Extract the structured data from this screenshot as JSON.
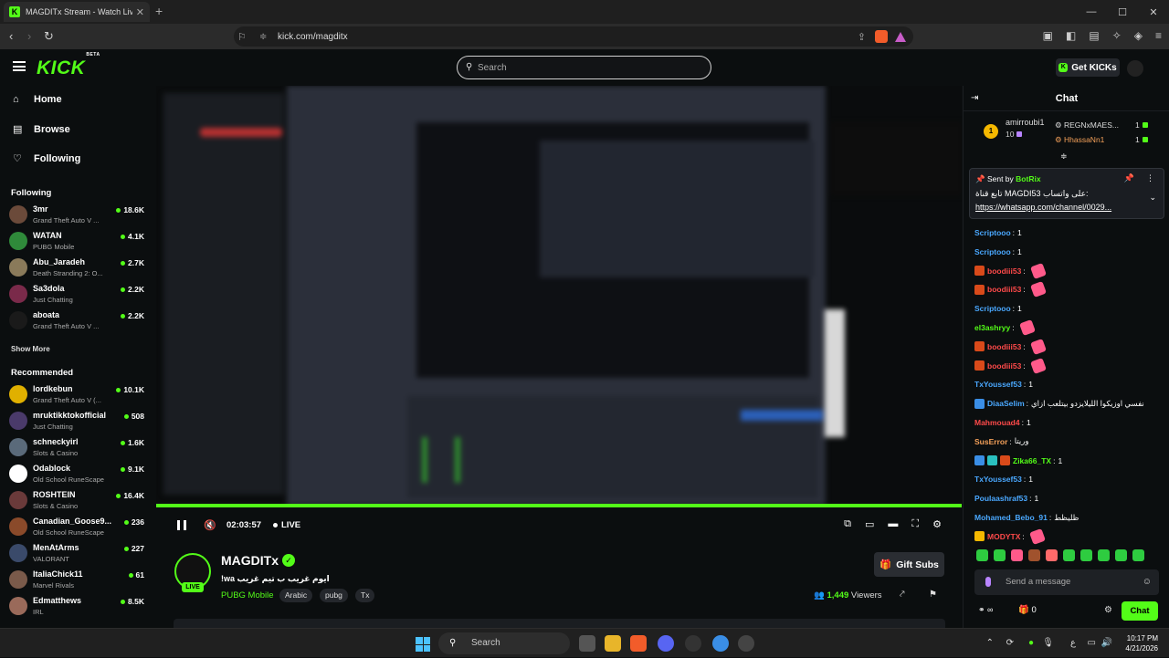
{
  "browser": {
    "tab_title": "MAGDITx Stream - Watch Live on Kick",
    "url": "kick.com/magditx"
  },
  "header": {
    "logo": "KICK",
    "logo_badge": "BETA",
    "search_placeholder": "Search",
    "get_kicks": "Get KICKs"
  },
  "sidebar": {
    "nav": [
      {
        "label": "Home",
        "icon": "home-icon"
      },
      {
        "label": "Browse",
        "icon": "browse-icon"
      },
      {
        "label": "Following",
        "icon": "heart-icon"
      }
    ],
    "following_title": "Following",
    "following": [
      {
        "name": "3mr",
        "category": "Grand Theft Auto V ...",
        "viewers": "18.6K",
        "color": "#6b4a3a"
      },
      {
        "name": "WATAN",
        "category": "PUBG Mobile",
        "viewers": "4.1K",
        "color": "#2f8a3a"
      },
      {
        "name": "Abu_Jaradeh",
        "category": "Death Stranding 2: O...",
        "viewers": "2.7K",
        "color": "#8a7a5a"
      },
      {
        "name": "Sa3dola",
        "category": "Just Chatting",
        "viewers": "2.2K",
        "color": "#7a2a4a"
      },
      {
        "name": "aboata",
        "category": "Grand Theft Auto V ...",
        "viewers": "2.2K",
        "color": "#1a1a1a"
      }
    ],
    "show_more": "Show More",
    "recommended_title": "Recommended",
    "recommended": [
      {
        "name": "lordkebun",
        "category": "Grand Theft Auto V (...",
        "viewers": "10.1K",
        "color": "#e0b000"
      },
      {
        "name": "mruktikktokofficial",
        "category": "Just Chatting",
        "viewers": "508",
        "color": "#4a3a6a"
      },
      {
        "name": "schneckyirl",
        "category": "Slots & Casino",
        "viewers": "1.6K",
        "color": "#5a6a7a"
      },
      {
        "name": "Odablock",
        "category": "Old School RuneScape",
        "viewers": "9.1K",
        "color": "#ffffff"
      },
      {
        "name": "ROSHTEIN",
        "category": "Slots & Casino",
        "viewers": "16.4K",
        "color": "#6a3a3a"
      },
      {
        "name": "Canadian_Goose9...",
        "category": "Old School RuneScape",
        "viewers": "236",
        "color": "#8a4a2a"
      },
      {
        "name": "MenAtArms",
        "category": "VALORANT",
        "viewers": "227",
        "color": "#3a4a6a"
      },
      {
        "name": "ItaliaChick11",
        "category": "Marvel Rivals",
        "viewers": "61",
        "color": "#7a5a4a"
      },
      {
        "name": "Edmatthews",
        "category": "IRL",
        "viewers": "8.5K",
        "color": "#9a6a5a"
      }
    ]
  },
  "player": {
    "elapsed": "02:03:57",
    "live": "LIVE",
    "progress": 1.0
  },
  "stream": {
    "channel": "MAGDITx",
    "live_badge": "LIVE",
    "title": "!wa ايوم غريب ب تيم غريب",
    "category": "PUBG Mobile",
    "tags": [
      "Arabic",
      "pubg",
      "Tx"
    ],
    "gift_subs": "Gift Subs",
    "viewers": "1,449",
    "viewers_label": "Viewers"
  },
  "chat": {
    "title": "Chat",
    "leaderboard": {
      "top_name": "amirroubi1",
      "top_count": "10",
      "top_rank": "1",
      "others": [
        {
          "name": "REGNxMAES...",
          "count": "1"
        },
        {
          "name": "HhassaNn1",
          "count": "1"
        }
      ]
    },
    "pinned": {
      "sent_by": "Sent by",
      "bot": "BotRix",
      "message": "تابع قناة MAGDI53 على واتساب:",
      "link": "https://whatsapp.com/channel/0029..."
    },
    "messages": [
      {
        "user": "Scriptooo",
        "text": "1",
        "color": "#4aa8ff",
        "badge": "",
        "emote": false
      },
      {
        "user": "Scriptooo",
        "text": "1",
        "color": "#4aa8ff",
        "badge": "",
        "emote": false
      },
      {
        "user": "boodiii53",
        "text": "",
        "color": "#ff4a4a",
        "badge": "crown",
        "emote": true
      },
      {
        "user": "boodiii53",
        "text": "",
        "color": "#ff4a4a",
        "badge": "crown",
        "emote": true
      },
      {
        "user": "Scriptooo",
        "text": "1",
        "color": "#4aa8ff",
        "badge": "",
        "emote": false
      },
      {
        "user": "el3ashryy",
        "text": "",
        "color": "#53fc18",
        "badge": "",
        "emote": true
      },
      {
        "user": "boodiii53",
        "text": "",
        "color": "#ff4a4a",
        "badge": "crown",
        "emote": true
      },
      {
        "user": "boodiii53",
        "text": "",
        "color": "#ff4a4a",
        "badge": "crown",
        "emote": true
      },
      {
        "user": "TxYoussef53",
        "text": "1",
        "color": "#4aa8ff",
        "badge": "",
        "emote": false
      },
      {
        "user": "DiaaSelim",
        "text": "نفسي اوزيكوا الليلايزدو بيتلعب ازاي",
        "color": "#4aa8ff",
        "badge": "blue",
        "emote": false
      },
      {
        "user": "Mahmouad4",
        "text": "1",
        "color": "#ff4a4a",
        "badge": "",
        "emote": false
      },
      {
        "user": "SusError",
        "text": "وريتا",
        "color": "#f5a15a",
        "badge": "",
        "emote": false
      },
      {
        "user": "Zika66_TX",
        "text": "1",
        "color": "#53fc18",
        "badge": "multi",
        "emote": false
      },
      {
        "user": "TxYoussef53",
        "text": "1",
        "color": "#4aa8ff",
        "badge": "",
        "emote": false
      },
      {
        "user": "Poulaashraf53",
        "text": "1",
        "color": "#4aa8ff",
        "badge": "",
        "emote": false
      },
      {
        "user": "Mohamed_Bebo_91",
        "text": "ظليظط",
        "color": "#4aa8ff",
        "badge": "",
        "emote": false
      },
      {
        "user": "MODYTX",
        "text": "",
        "color": "#ff4a4a",
        "badge": "crown-gold",
        "emote": true
      }
    ],
    "send_placeholder": "Send a message",
    "points": "∞",
    "gift_count": "0",
    "chat_button": "Chat"
  },
  "taskbar": {
    "search": "Search",
    "time": "10:17 PM",
    "date": "4/21/2026",
    "lang": "ع"
  }
}
